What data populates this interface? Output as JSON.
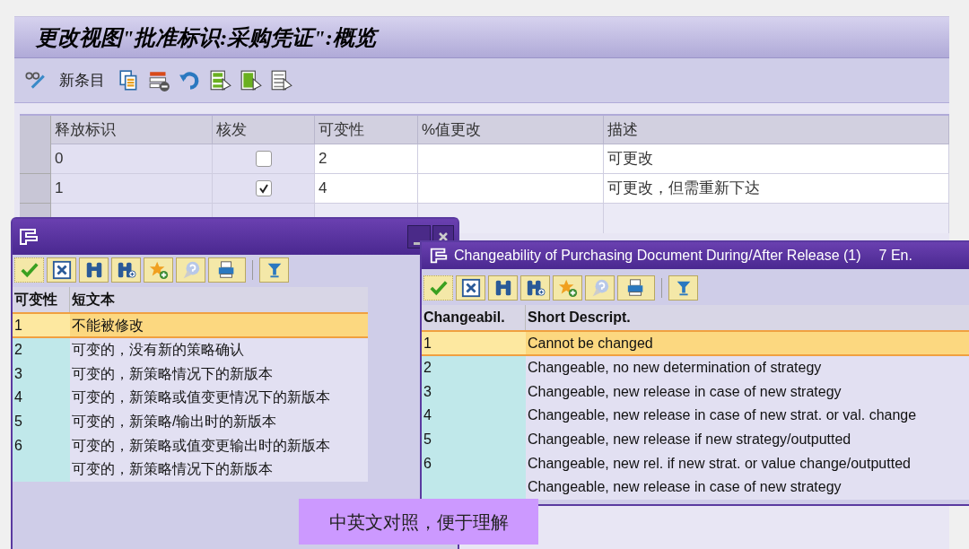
{
  "main": {
    "title": "更改视图\"批准标识:采购凭证\":概览",
    "toolbar": {
      "new_entries": "新条目"
    },
    "table": {
      "columns": [
        "释放标识",
        "核发",
        "可变性",
        "%值更改",
        "描述"
      ],
      "rows": [
        {
          "release_id": "0",
          "checked": false,
          "changeability": "2",
          "description": "可更改"
        },
        {
          "release_id": "1",
          "checked": true,
          "changeability": "4",
          "description": "可更改，但需重新下达"
        }
      ]
    }
  },
  "popup_cn": {
    "columns": [
      "可变性",
      "短文本"
    ],
    "rows": [
      {
        "key": "1",
        "text": "不能被修改",
        "selected": true
      },
      {
        "key": "2",
        "text": "可变的，没有新的策略确认",
        "selected": false
      },
      {
        "key": "3",
        "text": "可变的，新策略情况下的新版本",
        "selected": false
      },
      {
        "key": "4",
        "text": "可变的，新策略或值变更情况下的新版本",
        "selected": false
      },
      {
        "key": "5",
        "text": "可变的，新策略/输出时的新版本",
        "selected": false
      },
      {
        "key": "6",
        "text": "可变的，新策略或值变更输出时的新版本",
        "selected": false
      },
      {
        "text": "可变的，新策略情况下的新版本",
        "selected": false
      }
    ]
  },
  "popup_en": {
    "title": "Changeability of Purchasing Document During/After Release (1)",
    "entries": "7 En.",
    "columns": [
      "Changeabil.",
      "Short Descript."
    ],
    "rows": [
      {
        "key": "1",
        "text": "Cannot be changed",
        "selected": true
      },
      {
        "key": "2",
        "text": "Changeable, no new determination of strategy",
        "selected": false
      },
      {
        "key": "3",
        "text": "Changeable, new release in case of new strategy",
        "selected": false
      },
      {
        "key": "4",
        "text": "Changeable, new release in case of new strat. or val. change",
        "selected": false
      },
      {
        "key": "5",
        "text": "Changeable, new release if new strategy/outputted",
        "selected": false
      },
      {
        "key": "6",
        "text": "Changeable, new rel. if new strat. or value change/outputted",
        "selected": false
      },
      {
        "text": "Changeable, new release in case of new strategy",
        "selected": false
      }
    ]
  },
  "caption": "中英文对照，便于理解"
}
